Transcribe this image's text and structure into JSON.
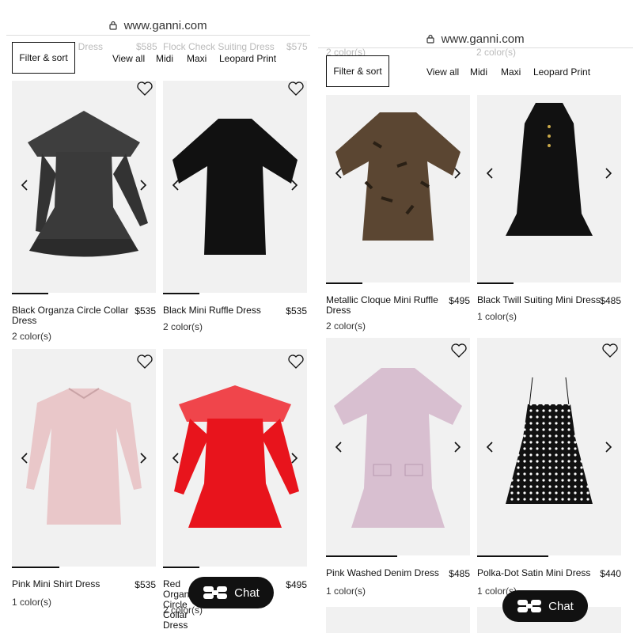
{
  "left": {
    "url": "www.ganni.com",
    "ghost_header": [
      "…nza Ivy Mini Dress",
      "$585",
      "Flock Check Suiting Dress",
      "$575"
    ],
    "filter_label": "Filter & sort",
    "nav": [
      "View all",
      "Midi",
      "Maxi",
      "Leopard Print"
    ],
    "products": [
      {
        "name": "Black Organza Circle Collar Dress",
        "price": "$535",
        "colors": "2 color(s)"
      },
      {
        "name": "Black Mini Ruffle Dress",
        "price": "$535",
        "colors": "2 color(s)"
      },
      {
        "name": "Pink Mini Shirt Dress",
        "price": "$535",
        "colors": "1 color(s)"
      },
      {
        "name": "Red Organza Circle Collar Dress",
        "price": "$495",
        "colors": "2 color(s)"
      }
    ],
    "chat_label": "Chat"
  },
  "right": {
    "url": "www.ganni.com",
    "ghost_header": [
      "2 color(s)",
      "2 color(s)"
    ],
    "filter_label": "Filter & sort",
    "nav": [
      "View all",
      "Midi",
      "Maxi",
      "Leopard Print"
    ],
    "products": [
      {
        "name": "Metallic Cloque Mini Ruffle Dress",
        "price": "$495",
        "colors": "2 color(s)"
      },
      {
        "name": "Black Twill Suiting Mini Dress",
        "price": "$485",
        "colors": "1 color(s)"
      },
      {
        "name": "Pink Washed Denim Dress",
        "price": "$485",
        "colors": "1 color(s)"
      },
      {
        "name": "Polka-Dot Satin Mini Dress",
        "price": "$440",
        "colors": "1 color(s)"
      }
    ],
    "chat_label": "Chat"
  },
  "icons": {
    "lock": "lock-icon",
    "heart": "heart-icon",
    "prev": "chevron-left-icon",
    "next": "chevron-right-icon",
    "chat_logo": "chat-logo-icon"
  },
  "colors": {
    "accent": "#111111",
    "card_bg": "#f1f1f1",
    "red_dress": "#e8141c",
    "pink_dress": "#e9c7c9"
  }
}
